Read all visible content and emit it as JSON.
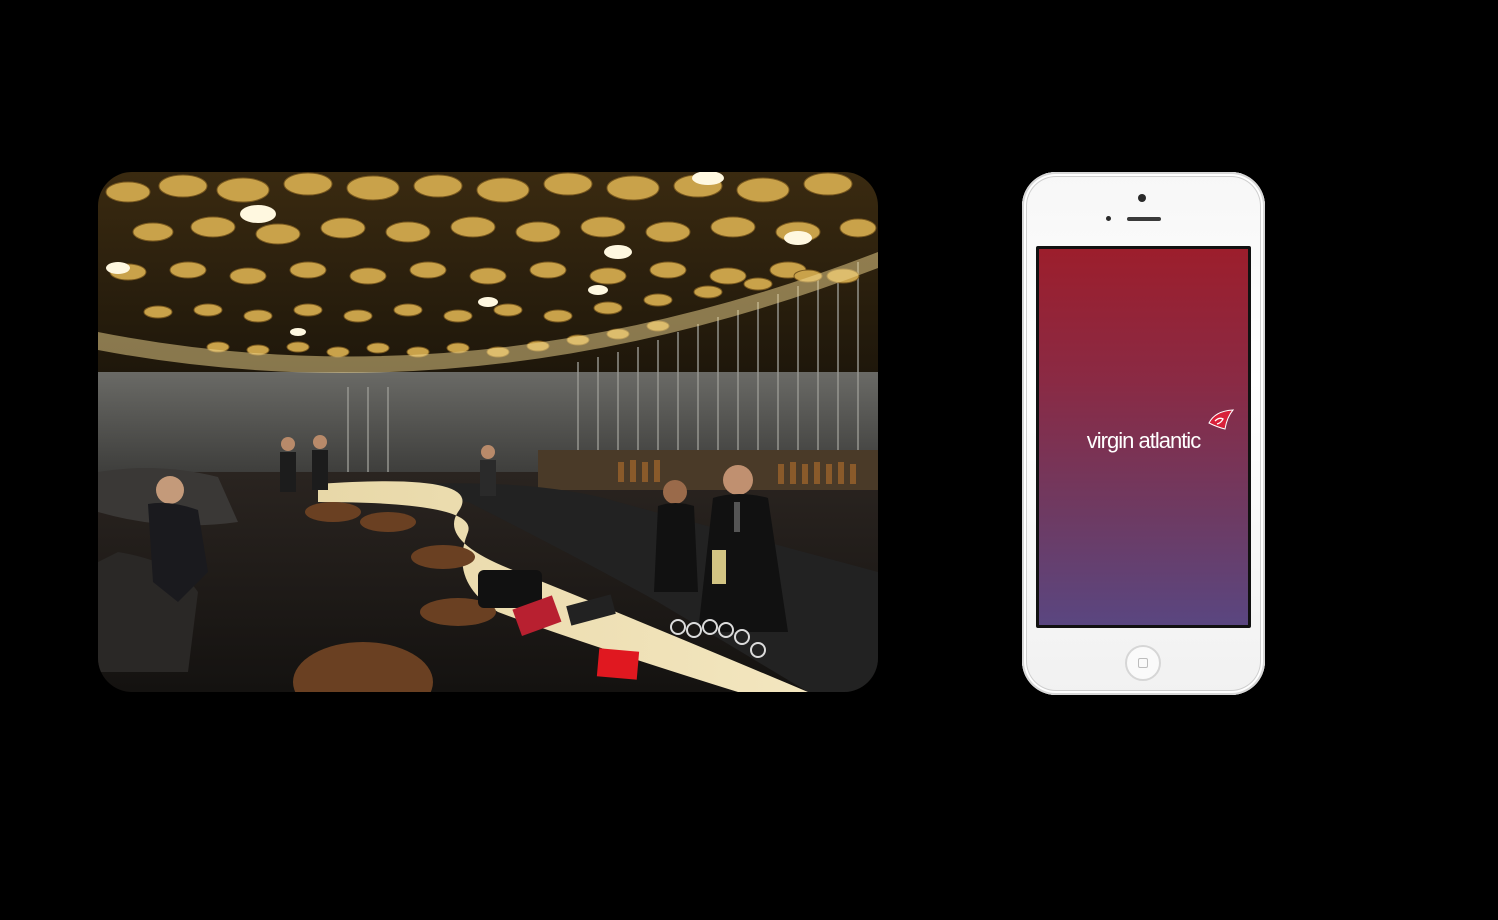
{
  "photo": {
    "alt": "",
    "icon": "lounge-bar-photo"
  },
  "phone": {
    "icon": "smartphone-icon",
    "app_wordmark": "virgin atlantic",
    "logo_icon": "virgin-logo-icon",
    "home_button_icon": "home-button-icon"
  },
  "colors": {
    "background": "#000000",
    "splash_top": "#9c1e2c",
    "splash_bottom": "#5a4680",
    "phone_body": "#ffffff"
  }
}
